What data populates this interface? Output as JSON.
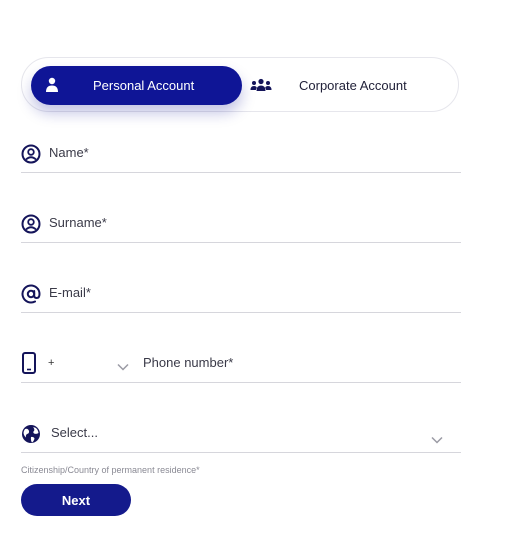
{
  "account_toggle": {
    "personal_label": "Personal Account",
    "corporate_label": "Corporate Account",
    "active": "personal"
  },
  "form": {
    "name_placeholder": "Name*",
    "surname_placeholder": "Surname*",
    "email_placeholder": "E-mail*",
    "phone_prefix": "+",
    "phone_placeholder": "Phone number*",
    "country_placeholder": "Select...",
    "country_hint": "Citizenship/Country of permanent residence*"
  },
  "actions": {
    "next_label": "Next"
  },
  "colors": {
    "accent": "#0f1596",
    "icon": "#14145a",
    "divider": "#d6d6dc"
  },
  "icons": [
    "user-icon",
    "group-icon",
    "user-circle-icon",
    "at-icon",
    "phone-icon",
    "chevron-down-icon",
    "globe-icon"
  ]
}
